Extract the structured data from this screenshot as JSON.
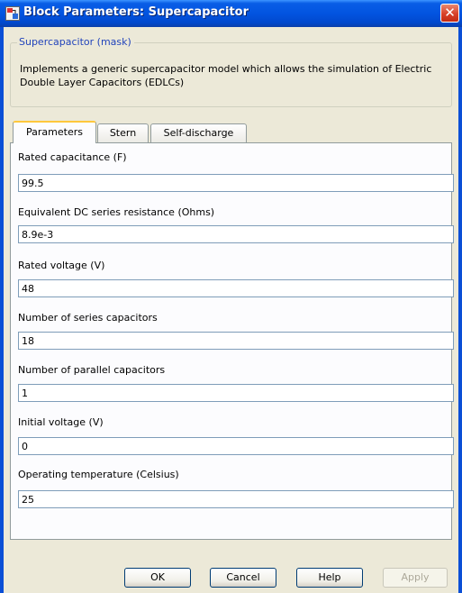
{
  "window": {
    "title": "Block Parameters: Supercapacitor",
    "icon": "simulink-block-icon",
    "close_icon": "close-icon"
  },
  "mask": {
    "legend": "Supercapacitor (mask)",
    "description": "Implements a generic supercapacitor model which allows the simulation of Electric Double Layer Capacitors (EDLCs)"
  },
  "tabs": [
    {
      "label": "Parameters",
      "active": true
    },
    {
      "label": "Stern",
      "active": false
    },
    {
      "label": "Self-discharge",
      "active": false
    }
  ],
  "fields": [
    {
      "label": "Rated capacitance (F)",
      "value": "99.5"
    },
    {
      "label": "Equivalent DC series resistance (Ohms)",
      "value": "8.9e-3"
    },
    {
      "label": "Rated voltage (V)",
      "value": "48"
    },
    {
      "label": "Number of series capacitors",
      "value": "18"
    },
    {
      "label": "Number of parallel capacitors",
      "value": "1"
    },
    {
      "label": "Initial voltage (V)",
      "value": "0"
    },
    {
      "label": "Operating temperature (Celsius)",
      "value": "25"
    }
  ],
  "buttons": {
    "ok": "OK",
    "cancel": "Cancel",
    "help": "Help",
    "apply": "Apply"
  },
  "colors": {
    "titlebar": "#0254e0",
    "dialog_bg": "#ece9d8",
    "legend_text": "#2244bb",
    "active_tab_accent": "#ffc83c"
  }
}
